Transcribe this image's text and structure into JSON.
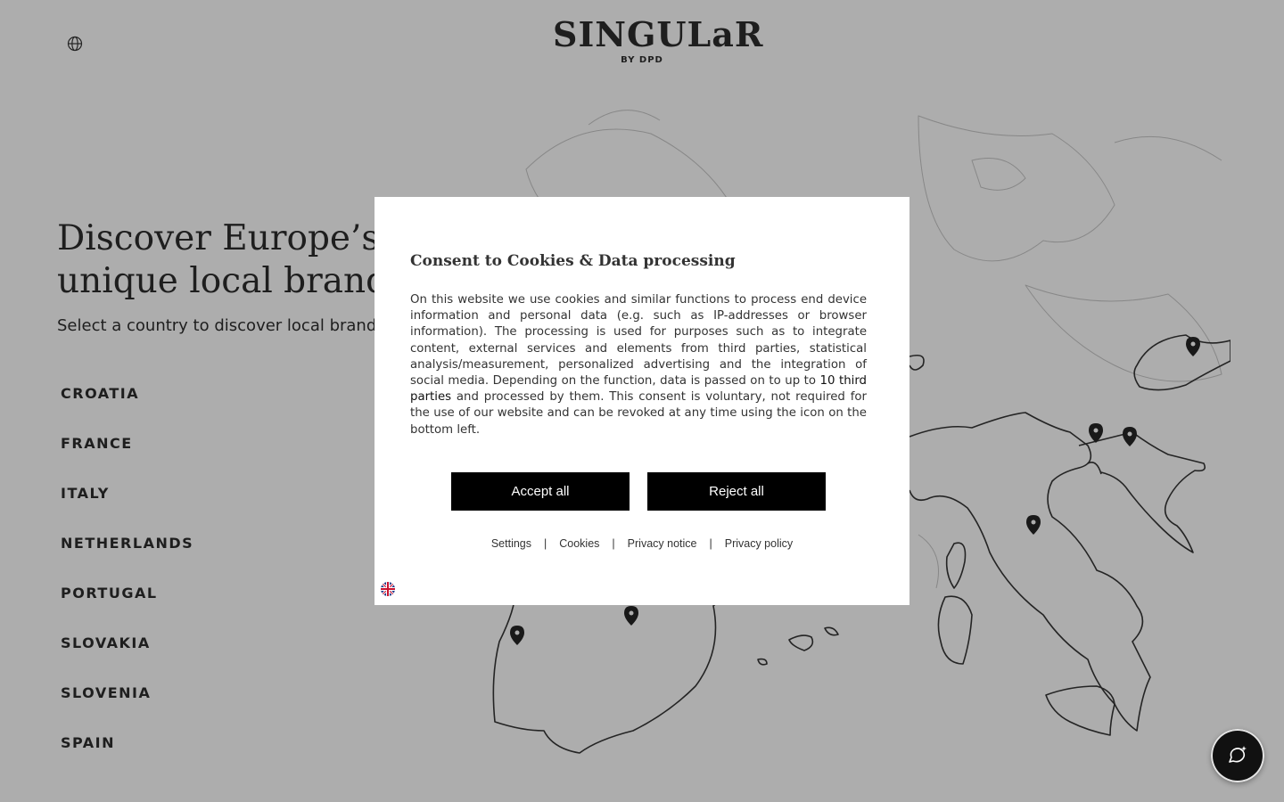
{
  "header": {
    "logo_text": "SINGULaR",
    "logo_sub": "BY DPD",
    "language_icon": "globe-icon"
  },
  "hero": {
    "title": "Discover Europe’s most unique local brands",
    "subtitle": "Select a country to discover local brands"
  },
  "countries": [
    "CROATIA",
    "FRANCE",
    "ITALY",
    "NETHERLANDS",
    "PORTUGAL",
    "SLOVAKIA",
    "SLOVENIA",
    "SPAIN"
  ],
  "map": {
    "marker_icon": "map-pin-icon",
    "marker_count": 7
  },
  "consent": {
    "title": "Consent to Cookies & Data processing",
    "body_before_link": "On this website we use cookies and similar functions to process end device information and personal data (e.g. such as IP-addresses or browser information). The processing is used for purposes such as to integrate content, external services and elements from third parties, statistical analysis/measurement, personalized advertising and the integration of social media. Depending on the function, data is passed on to up to ",
    "body_link": "10 third parties",
    "body_after_link": " and processed by them. This consent is voluntary, not required for the use of our website and can be revoked at any time using the icon on the bottom left.",
    "accept_label": "Accept all",
    "reject_label": "Reject all",
    "links": [
      "Settings",
      "Cookies",
      "Privacy notice",
      "Privacy policy"
    ],
    "separator": "|",
    "language_flag": "uk-flag-icon"
  },
  "chat": {
    "icon": "chat-sparkle-icon"
  },
  "colors": {
    "background": "#f4f4f4",
    "overlay": "rgba(40,40,40,0.35)",
    "button": "#000000",
    "text": "#1a1a1a"
  }
}
